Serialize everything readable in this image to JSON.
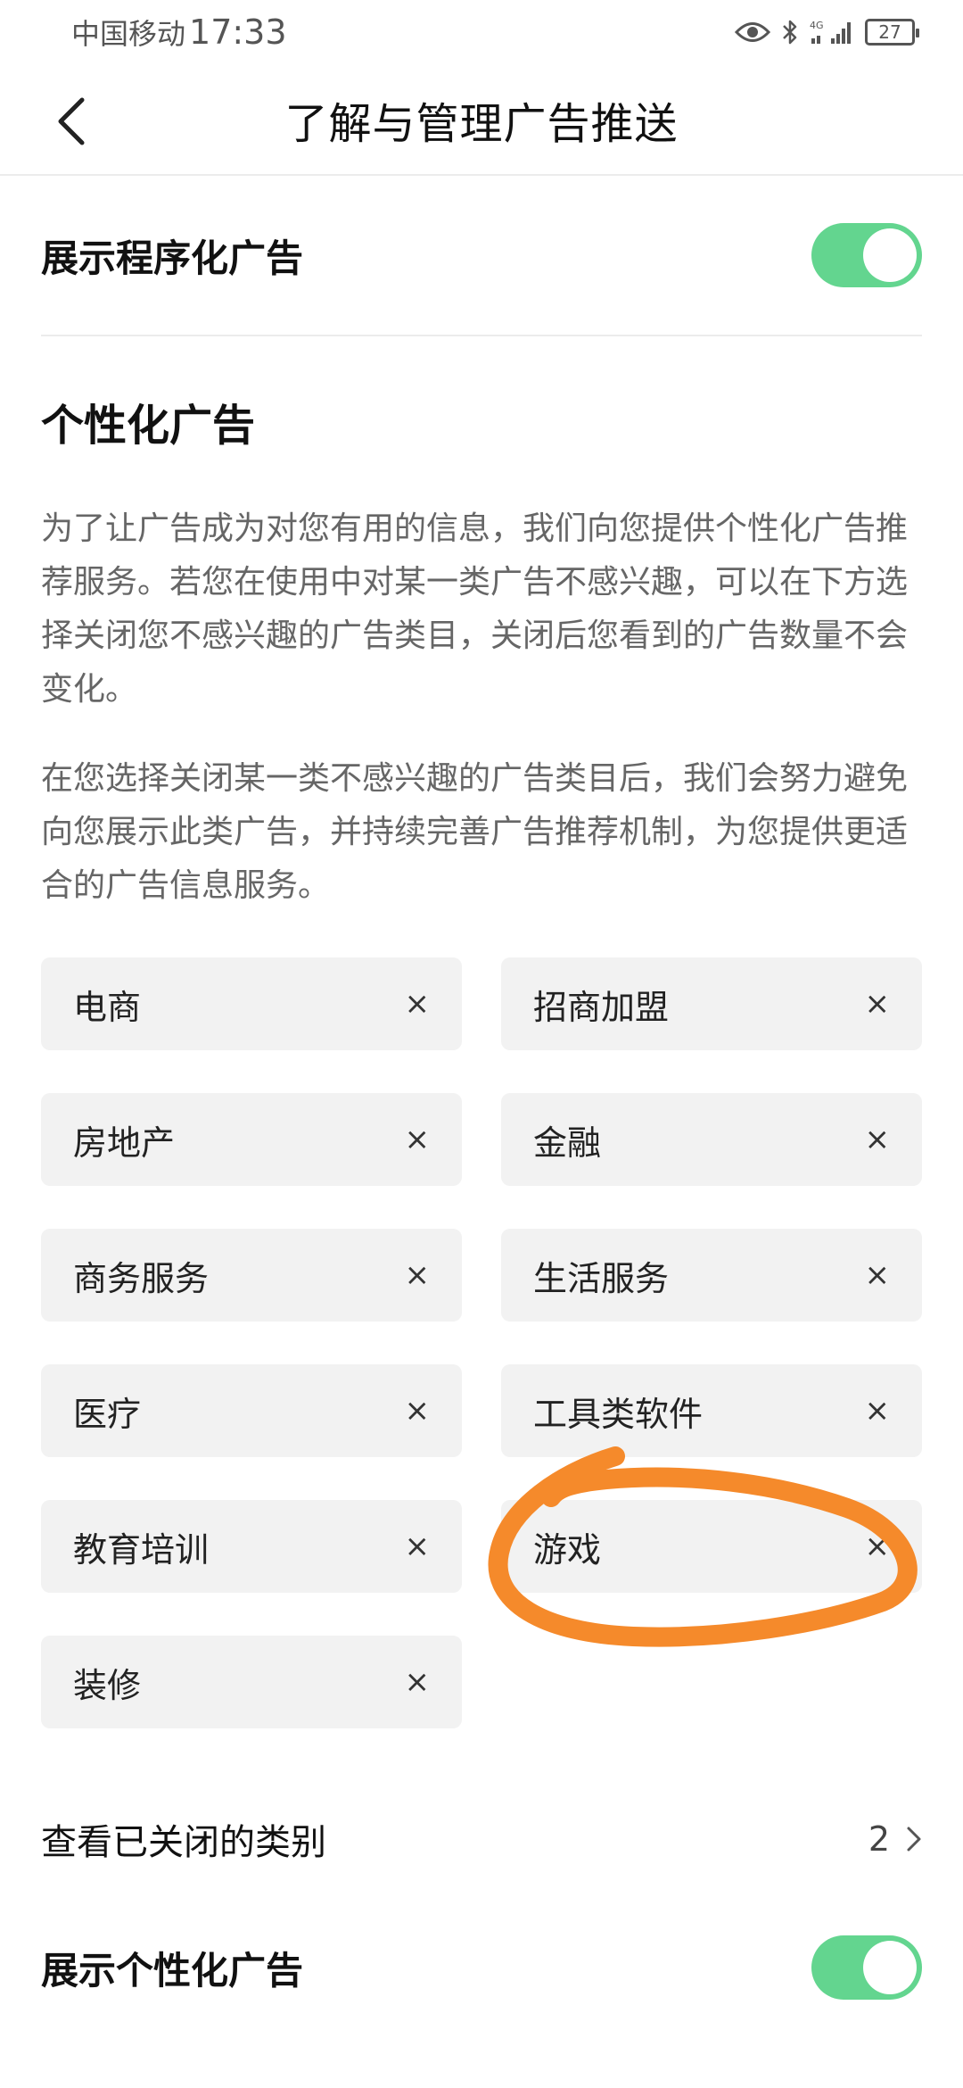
{
  "status_bar": {
    "carrier": "中国移动",
    "time": "17:33",
    "network": "4G",
    "battery": "27"
  },
  "header": {
    "title": "了解与管理广告推送"
  },
  "programmatic_ads": {
    "label": "展示程序化广告",
    "enabled": true
  },
  "personalized": {
    "title": "个性化广告",
    "paragraph1": "为了让广告成为对您有用的信息，我们向您提供个性化广告推荐服务。若您在使用中对某一类广告不感兴趣，可以在下方选择关闭您不感兴趣的广告类目，关闭后您看到的广告数量不会变化。",
    "paragraph2": "在您选择关闭某一类不感兴趣的广告类目后，我们会努力避免向您展示此类广告，并持续完善广告推荐机制，为您提供更适合的广告信息服务。"
  },
  "categories": [
    {
      "label": "电商"
    },
    {
      "label": "招商加盟"
    },
    {
      "label": "房地产"
    },
    {
      "label": "金融"
    },
    {
      "label": "商务服务"
    },
    {
      "label": "生活服务"
    },
    {
      "label": "医疗"
    },
    {
      "label": "工具类软件"
    },
    {
      "label": "教育培训"
    },
    {
      "label": "游戏"
    },
    {
      "label": "装修"
    }
  ],
  "close_glyph": "×",
  "closed_categories": {
    "label": "查看已关闭的类别",
    "count": "2"
  },
  "personalized_ads": {
    "label": "展示个性化广告",
    "enabled": true
  },
  "colors": {
    "toggle_on": "#63d58f",
    "chip_bg": "#f2f2f2",
    "annotation": "#f58a2b"
  }
}
